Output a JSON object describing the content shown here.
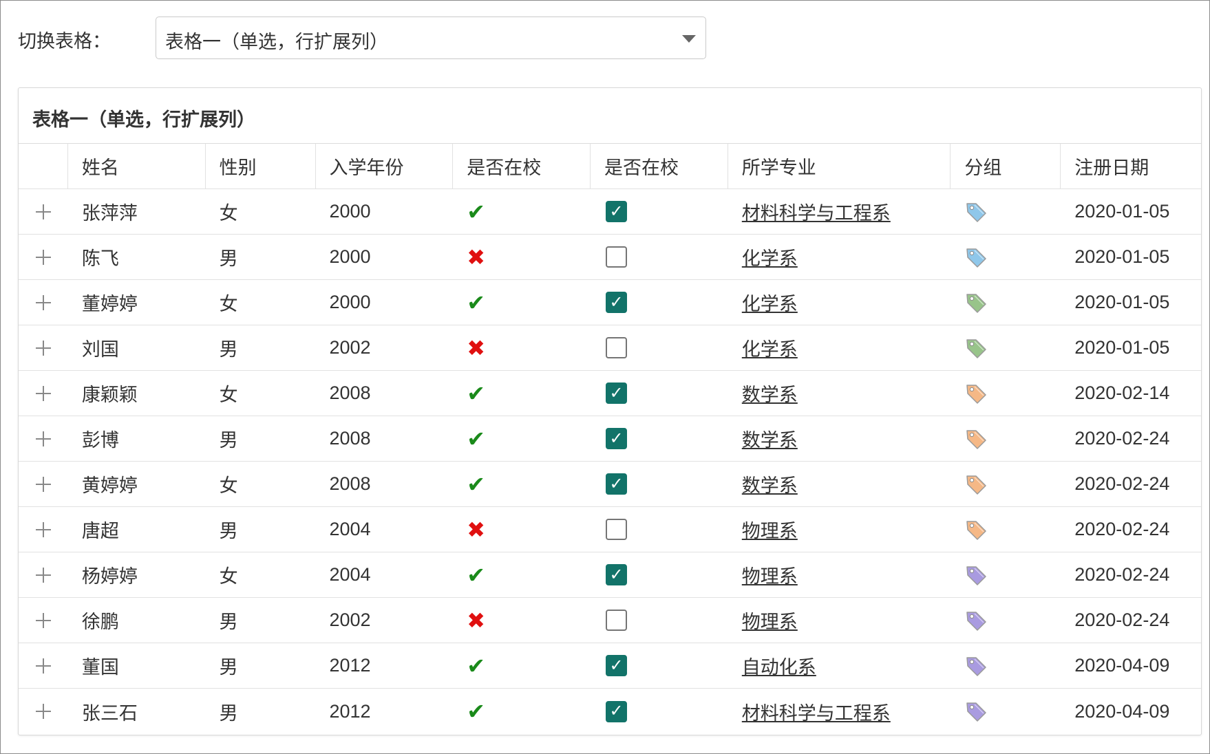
{
  "switcher": {
    "label": "切换表格：",
    "selected": "表格一（单选，行扩展列）"
  },
  "panel": {
    "title": "表格一（单选，行扩展列）"
  },
  "columns": {
    "name": "姓名",
    "sex": "性别",
    "year": "入学年份",
    "at_school_1": "是否在校",
    "at_school_2": "是否在校",
    "major": "所学专业",
    "group": "分组",
    "date": "注册日期"
  },
  "colors": {
    "yes": "#1a8a1a",
    "no": "#e01010",
    "checkbox_on": "#127369"
  },
  "icons": {
    "yes": "✔",
    "no": "✖",
    "check": "✓",
    "expand": "plus-icon",
    "group": "tag-icon"
  },
  "rows": [
    {
      "name": "张萍萍",
      "sex": "女",
      "year": "2000",
      "at_school": true,
      "major": "材料科学与工程系",
      "group_color": "#8fc7ea",
      "date": "2020-01-05"
    },
    {
      "name": "陈飞",
      "sex": "男",
      "year": "2000",
      "at_school": false,
      "major": "化学系",
      "group_color": "#8fc7ea",
      "date": "2020-01-05"
    },
    {
      "name": "董婷婷",
      "sex": "女",
      "year": "2000",
      "at_school": true,
      "major": "化学系",
      "group_color": "#98c48a",
      "date": "2020-01-05"
    },
    {
      "name": "刘国",
      "sex": "男",
      "year": "2002",
      "at_school": false,
      "major": "化学系",
      "group_color": "#98c48a",
      "date": "2020-01-05"
    },
    {
      "name": "康颖颖",
      "sex": "女",
      "year": "2008",
      "at_school": true,
      "major": "数学系",
      "group_color": "#f5b886",
      "date": "2020-02-14"
    },
    {
      "name": "彭博",
      "sex": "男",
      "year": "2008",
      "at_school": true,
      "major": "数学系",
      "group_color": "#f5b886",
      "date": "2020-02-24"
    },
    {
      "name": "黄婷婷",
      "sex": "女",
      "year": "2008",
      "at_school": true,
      "major": "数学系",
      "group_color": "#f5b886",
      "date": "2020-02-24"
    },
    {
      "name": "唐超",
      "sex": "男",
      "year": "2004",
      "at_school": false,
      "major": "物理系",
      "group_color": "#f5b886",
      "date": "2020-02-24"
    },
    {
      "name": "杨婷婷",
      "sex": "女",
      "year": "2004",
      "at_school": true,
      "major": "物理系",
      "group_color": "#a99be0",
      "date": "2020-02-24"
    },
    {
      "name": "徐鹏",
      "sex": "男",
      "year": "2002",
      "at_school": false,
      "major": "物理系",
      "group_color": "#a99be0",
      "date": "2020-02-24"
    },
    {
      "name": "董国",
      "sex": "男",
      "year": "2012",
      "at_school": true,
      "major": "自动化系",
      "group_color": "#a99be0",
      "date": "2020-04-09"
    },
    {
      "name": "张三石",
      "sex": "男",
      "year": "2012",
      "at_school": true,
      "major": "材料科学与工程系",
      "group_color": "#a99be0",
      "date": "2020-04-09"
    }
  ]
}
